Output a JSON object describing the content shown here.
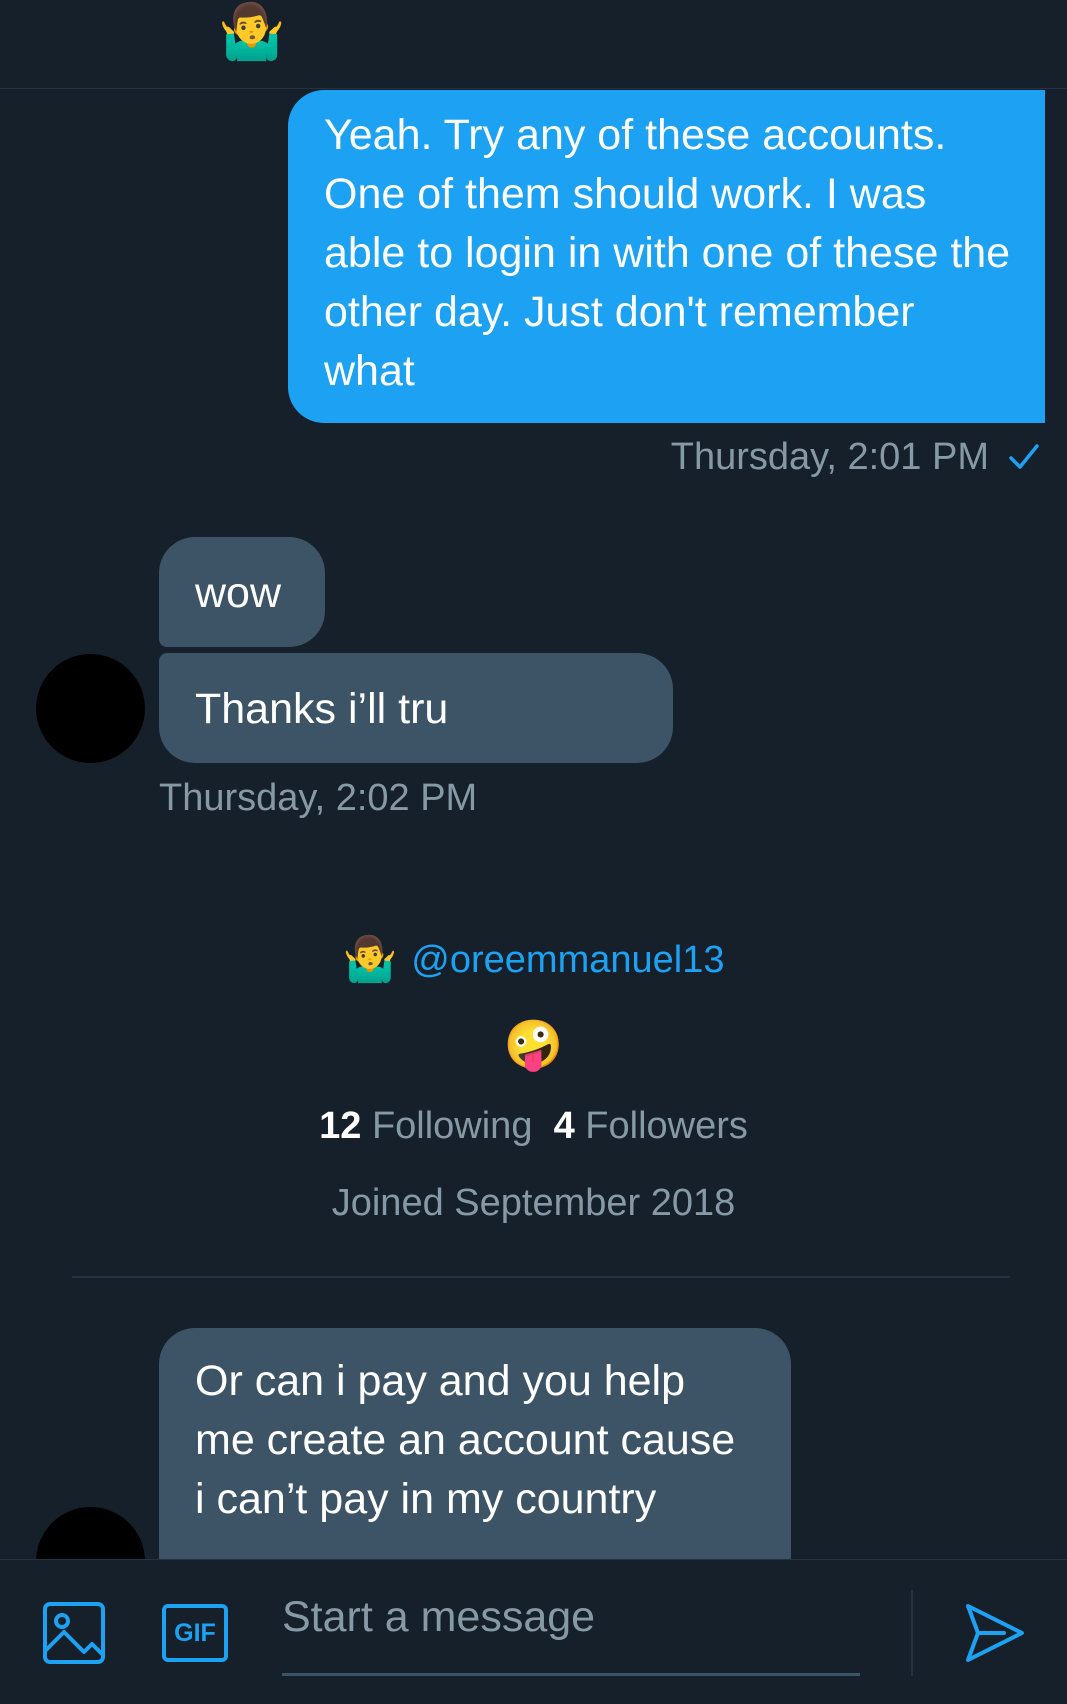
{
  "header": {
    "emoji": "🤷‍♂️"
  },
  "messages": {
    "outgoing": {
      "text": "Yeah. Try any of these accounts. One of them should work. I was able to login in with one of these the other day. Just don't remember what",
      "timestamp": "Thursday, 2:01 PM",
      "status_icon": "check-icon"
    },
    "incoming": {
      "first": "wow",
      "second": "Thanks i’ll tru",
      "timestamp": "Thursday, 2:02 PM",
      "third": "Or can i pay and you help me create an account cause i can’t pay in my country"
    }
  },
  "profile": {
    "handle_emoji": "🤷‍♂️",
    "handle": "@oreemmanuel13",
    "bio_emoji": "🤪",
    "following_count": "12",
    "following_label": "Following",
    "followers_count": "4",
    "followers_label": "Followers",
    "joined": "Joined September 2018"
  },
  "composer": {
    "placeholder": "Start a message",
    "gif_label": "GIF",
    "image_icon": "image-icon",
    "send_icon": "send-icon"
  },
  "colors": {
    "background": "#15202b",
    "accent": "#1da1f2",
    "incoming_bubble": "#3d5466",
    "secondary_text": "#8899a6"
  }
}
